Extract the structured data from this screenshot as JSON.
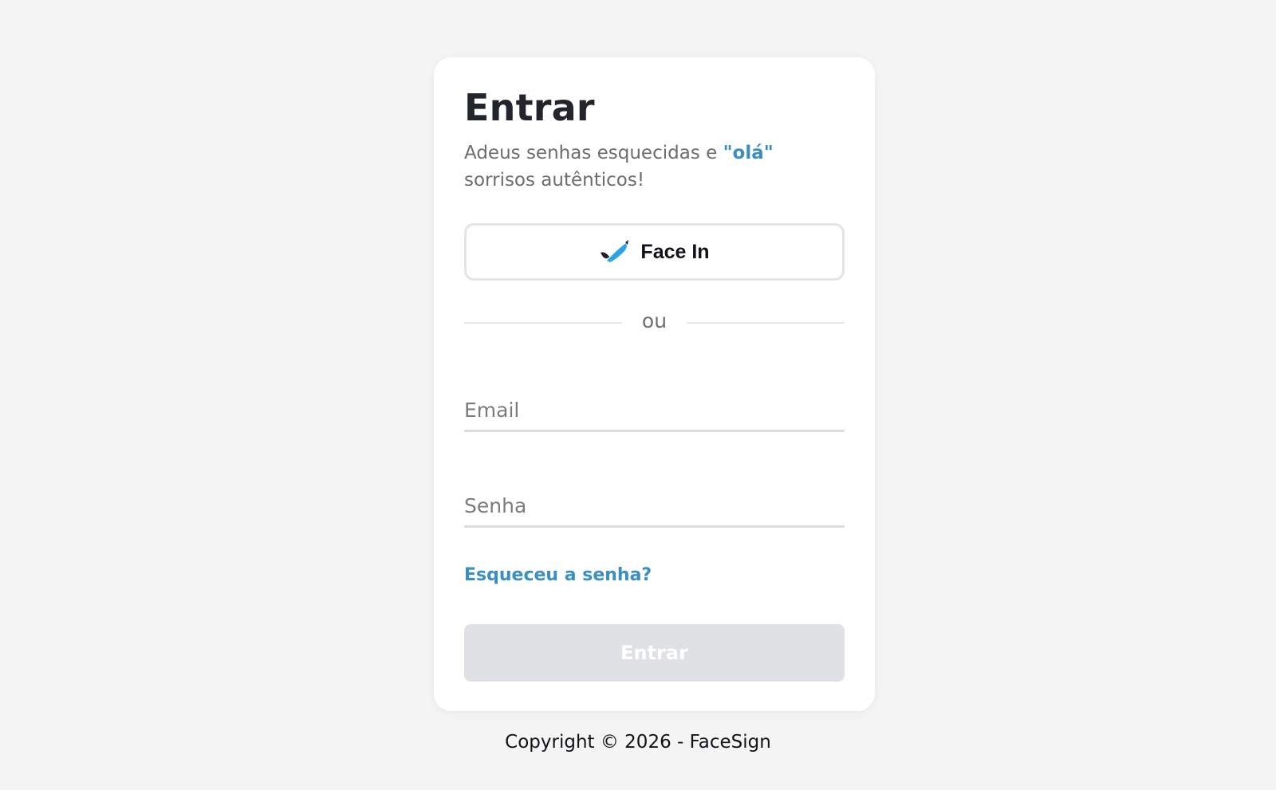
{
  "login": {
    "title": "Entrar",
    "subtitle_prefix": "Adeus senhas esquecidas e ",
    "subtitle_accent": "\"olá\"",
    "subtitle_suffix": " sorrisos autênticos!",
    "face_button_label": "Face In",
    "divider_text": "ou",
    "email_placeholder": "Email",
    "email_value": "",
    "password_placeholder": "Senha",
    "password_value": "",
    "forgot_label": "Esqueceu a senha?",
    "submit_label": "Entrar"
  },
  "footer": {
    "copyright": "Copyright © 2026 - FaceSign"
  },
  "icons": {
    "face_in_logo": "facesign-check-logo"
  },
  "colors": {
    "accent": "#3b8fc0",
    "background": "#f4f4f4",
    "submit_disabled": "#dfe1e5"
  }
}
